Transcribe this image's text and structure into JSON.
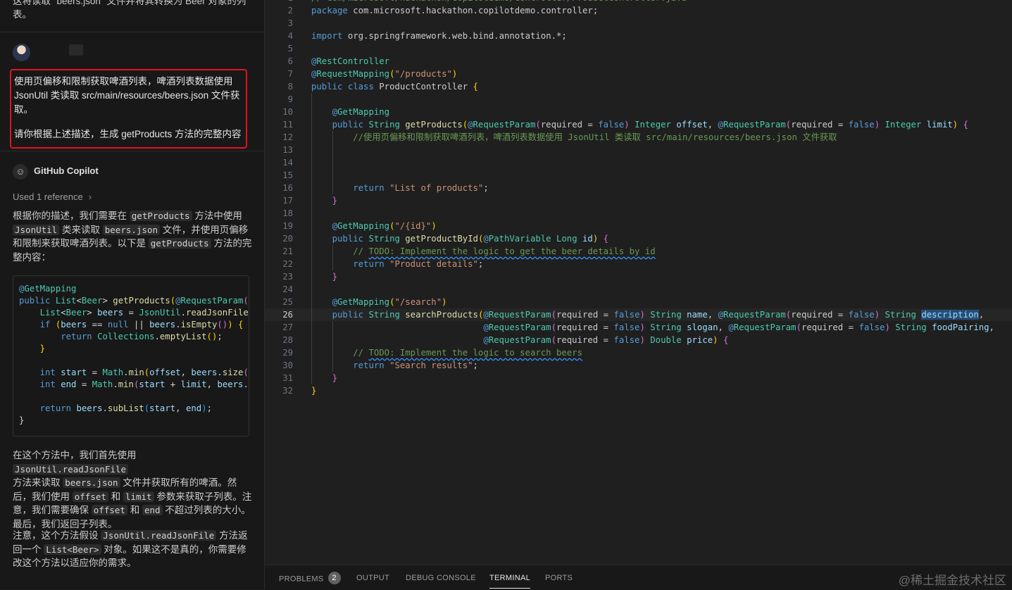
{
  "chat": {
    "previous_text_line1": "这将读取 \"beers.json\" 文件并将其转换为 Beer 对象的列",
    "previous_text_line2": "表。",
    "user_message": {
      "line1": "使用页偏移和限制获取啤酒列表，啤酒列表数据使用",
      "line2": "JsonUtil 类读取 src/main/resources/beers.json 文件获",
      "line3": "取。",
      "line4": "请你根据上述描述，生成 getProducts 方法的完整内容"
    },
    "copilot_name": "GitHub Copilot",
    "used_reference": "Used 1 reference",
    "answer_intro": {
      "p1a": "根据你的描述，我们需要在",
      "code1": "getProducts",
      "p1b": "方法中使用",
      "code2": "JsonUtil",
      "p1c": "类来读取",
      "code3": "beers.json",
      "p1d": "文件，并使用页偏移和限制来获取啤酒列表。以下是",
      "code4": "getProducts",
      "p1e": "方法的完整内容："
    },
    "code_lines": [
      "@GetMapping",
      "public List<Beer> getProducts(@RequestParam(re",
      "    List<Beer> beers = JsonUtil.readJsonFile(\"",
      "    if (beers == null || beers.isEmpty()) {",
      "        return Collections.emptyList();",
      "    }",
      "",
      "    int start = Math.min(offset, beers.size()",
      "    int end = Math.min(start + limit, beers.s",
      "",
      "    return beers.subList(start, end);",
      "}"
    ],
    "answer_p2": {
      "a": "在这个方法中，我们首先使用",
      "code1": "JsonUtil.readJsonFile",
      "b": "方法来读取",
      "code2": "beers.json",
      "c": "文件并获取所有的啤酒。然后，我们使用",
      "code3": "offset",
      "d": "和",
      "code4": "limit",
      "e": "参数来获取子列表。注意，我们需要确保",
      "code5": "offset",
      "f": "和",
      "code6": "end",
      "g": "不超过列表的大小。最后，我们返回子列表。"
    },
    "answer_p3": {
      "a": "注意，这个方法假设",
      "code1": "JsonUtil.readJsonFile",
      "b": "方法返回一个",
      "code2": "List<Beer>",
      "c": "对象。如果这不是真的，你需要修改这个方法以适应你的需求。"
    }
  },
  "editor": {
    "lines": [
      {
        "n": "1",
        "text": "// com/microsoft/hackathon/copilotdemo/controller/ProductController.java"
      },
      {
        "n": "2",
        "text": "package com.microsoft.hackathon.copilotdemo.controller;"
      },
      {
        "n": "3",
        "text": ""
      },
      {
        "n": "4",
        "text": "import org.springframework.web.bind.annotation.*;"
      },
      {
        "n": "5",
        "text": ""
      },
      {
        "n": "6",
        "text": "@RestController"
      },
      {
        "n": "7",
        "text": "@RequestMapping(\"/products\")"
      },
      {
        "n": "8",
        "text": "public class ProductController {"
      },
      {
        "n": "9",
        "text": ""
      },
      {
        "n": "10",
        "text": "    @GetMapping"
      },
      {
        "n": "11",
        "text": "    public String getProducts(@RequestParam(required = false) Integer offset, @RequestParam(required = false) Integer limit) {"
      },
      {
        "n": "12",
        "text": "        //使用页偏移和限制获取啤酒列表，啤酒列表数据使用 JsonUtil 类读取 src/main/resources/beers.json 文件获取"
      },
      {
        "n": "13",
        "text": ""
      },
      {
        "n": "14",
        "text": ""
      },
      {
        "n": "15",
        "text": ""
      },
      {
        "n": "16",
        "text": "        return \"List of products\";"
      },
      {
        "n": "17",
        "text": "    }"
      },
      {
        "n": "18",
        "text": ""
      },
      {
        "n": "19",
        "text": "    @GetMapping(\"/{id}\")"
      },
      {
        "n": "20",
        "text": "    public String getProductById(@PathVariable Long id) {"
      },
      {
        "n": "21",
        "text": "        // TODO: Implement the logic to get the beer details by id"
      },
      {
        "n": "22",
        "text": "        return \"Product details\";"
      },
      {
        "n": "23",
        "text": "    }"
      },
      {
        "n": "24",
        "text": ""
      },
      {
        "n": "25",
        "text": "    @GetMapping(\"/search\")"
      },
      {
        "n": "26",
        "text": "    public String searchProducts(@RequestParam(required = false) String name, @RequestParam(required = false) String description,"
      },
      {
        "n": "27",
        "text": "                                 @RequestParam(required = false) String slogan, @RequestParam(required = false) String foodPairing,"
      },
      {
        "n": "28",
        "text": "                                 @RequestParam(required = false) Double price) {"
      },
      {
        "n": "29",
        "text": "        // TODO: Implement the logic to search beers"
      },
      {
        "n": "30",
        "text": "        return \"Search results\";"
      },
      {
        "n": "31",
        "text": "    }"
      },
      {
        "n": "32",
        "text": "}"
      }
    ],
    "current_line": "26"
  },
  "panel": {
    "tabs": [
      {
        "label": "PROBLEMS",
        "badge": "2"
      },
      {
        "label": "OUTPUT"
      },
      {
        "label": "DEBUG CONSOLE"
      },
      {
        "label": "TERMINAL",
        "active": true
      },
      {
        "label": "PORTS"
      }
    ],
    "watermark": "@稀土掘金技术社区"
  }
}
